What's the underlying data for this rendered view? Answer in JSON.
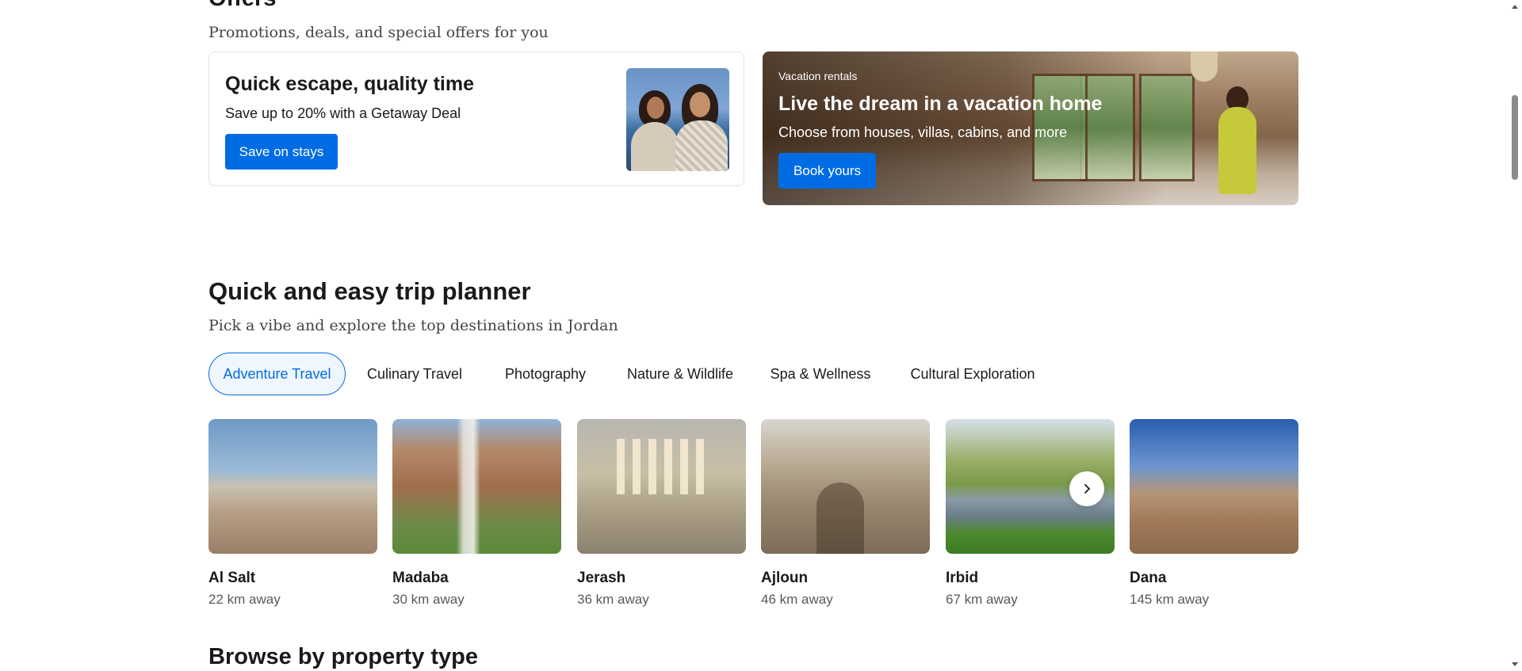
{
  "offers": {
    "title": "Offers",
    "subtitle": "Promotions, deals, and special offers for you",
    "getaway": {
      "title": "Quick escape, quality time",
      "description": "Save up to 20% with a Getaway Deal",
      "button": "Save on stays"
    },
    "vacation": {
      "eyebrow": "Vacation rentals",
      "title": "Live the dream in a vacation home",
      "description": "Choose from houses, villas, cabins, and more",
      "button": "Book yours"
    }
  },
  "planner": {
    "title": "Quick and easy trip planner",
    "subtitle": "Pick a vibe and explore the top destinations in Jordan",
    "tabs": [
      {
        "label": "Adventure Travel",
        "active": true
      },
      {
        "label": "Culinary Travel"
      },
      {
        "label": "Photography"
      },
      {
        "label": "Nature & Wildlife"
      },
      {
        "label": "Spa & Wellness"
      },
      {
        "label": "Cultural Exploration"
      }
    ],
    "destinations": [
      {
        "name": "Al Salt",
        "distance": "22 km away"
      },
      {
        "name": "Madaba",
        "distance": "30 km away"
      },
      {
        "name": "Jerash",
        "distance": "36 km away"
      },
      {
        "name": "Ajloun",
        "distance": "46 km away"
      },
      {
        "name": "Irbid",
        "distance": "67 km away"
      },
      {
        "name": "Dana",
        "distance": "145 km away"
      }
    ],
    "next_icon": "chevron-right-icon"
  },
  "browse": {
    "title": "Browse by property type"
  },
  "colors": {
    "accent": "#006ce4",
    "active_chip_bg": "#f0f6fd"
  }
}
